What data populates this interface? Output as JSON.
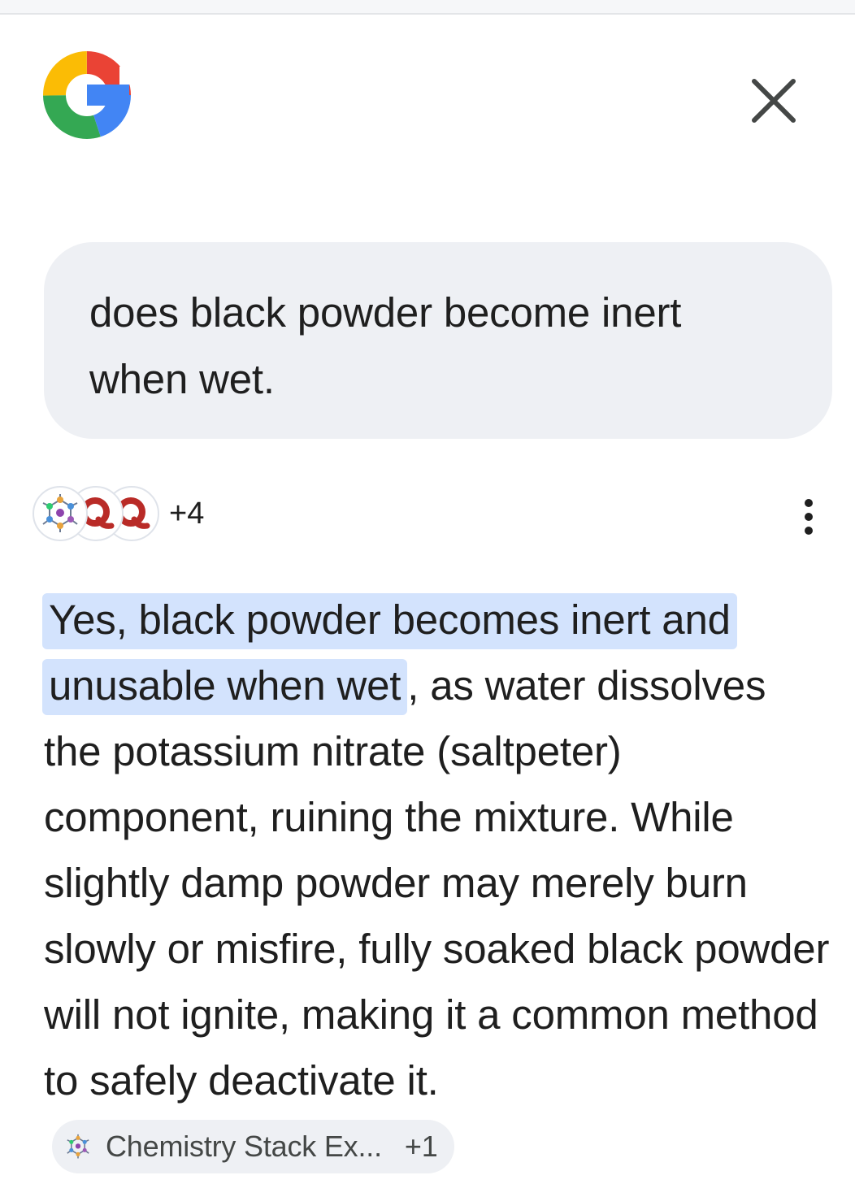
{
  "header": {
    "logo_icon": "google-g-logo",
    "close_icon": "close-icon"
  },
  "query": {
    "text": "does black powder become inert when wet."
  },
  "sources": {
    "icons": [
      "chemistry-stack-exchange-icon",
      "quora-icon",
      "quora-icon"
    ],
    "extra_count": "+4",
    "menu_icon": "more-vert-icon"
  },
  "answer": {
    "highlight": "Yes, black powder becomes inert and unusable when wet",
    "body": ", as water dissolves the potassium nitrate (saltpeter) component, ruining the mixture. While slightly damp powder may merely burn slowly or misfire, fully soaked black powder will not ignite, making it a common method to safely deactivate it.",
    "citation": {
      "label": "Chemistry Stack Ex...",
      "extra": "+1",
      "icon": "chemistry-stack-exchange-icon"
    }
  },
  "colors": {
    "highlight": "#d3e3fd",
    "bubble": "#eef0f4",
    "quora_red": "#b92b27"
  }
}
